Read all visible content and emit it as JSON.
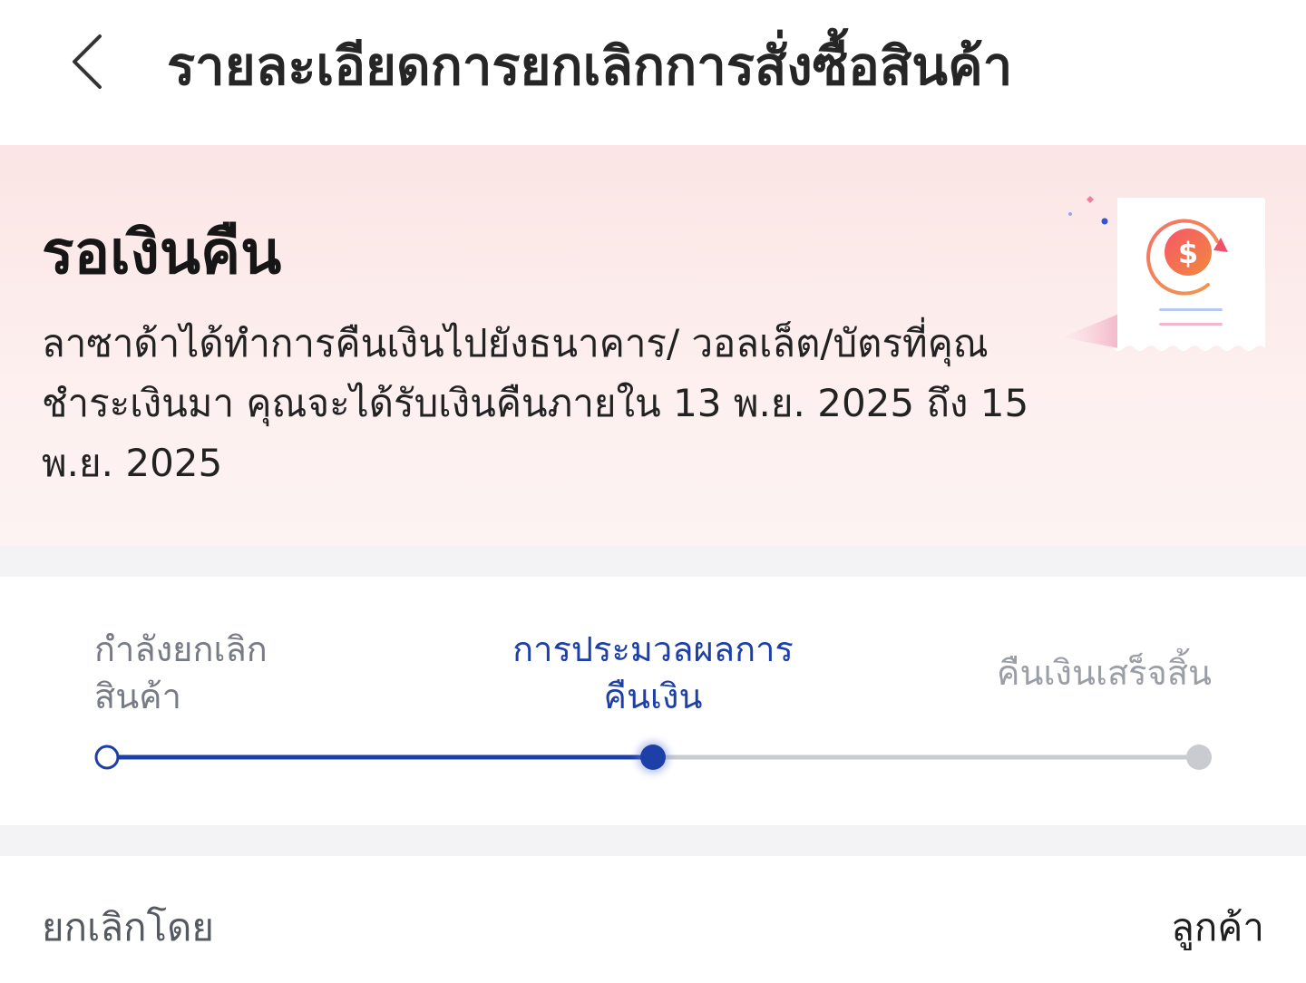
{
  "header": {
    "title": "รายละเอียดการยกเลิกการสั่งซื้อสินค้า",
    "back_icon": "chevron-left-icon"
  },
  "status": {
    "title": "รอเงินคืน",
    "description": "ลาซาด้าได้ทำการคืนเงินไปยังธนาคาร/ วอลเล็ต/บัตรที่คุณชำระเงินมา คุณจะได้รับเงินคืนภายใน 13 พ.ย. 2025 ถึง 15 พ.ย. 2025",
    "illustration_icon": "refund-receipt-icon"
  },
  "progress": {
    "steps": [
      {
        "label_line1": "กำลังยกเลิก",
        "label_line2": "สินค้า",
        "state": "completed"
      },
      {
        "label_line1": "การประมวลผลการ",
        "label_line2": "คืนเงิน",
        "state": "current"
      },
      {
        "label_line1": "คืนเงินเสร็จสิ้น",
        "label_line2": "",
        "state": "pending"
      }
    ],
    "colors": {
      "active": "#1d3fa8",
      "inactive": "#c9cbd1",
      "muted_text": "#777b85"
    }
  },
  "info": {
    "cancelled_by_label": "ยกเลิกโดย",
    "cancelled_by_value": "ลูกค้า"
  }
}
